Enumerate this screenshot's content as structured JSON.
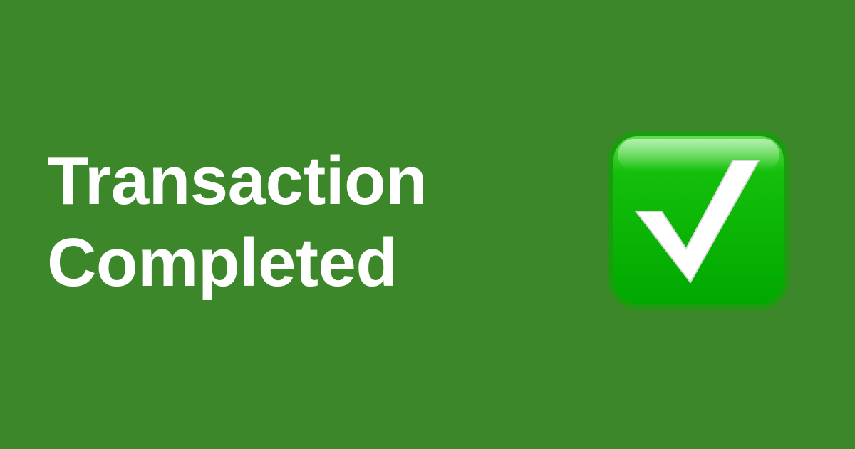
{
  "banner": {
    "background_color": "#3c8729",
    "text_color": "#ffffff",
    "headline": {
      "line1": "Transaction",
      "line2": "Completed"
    },
    "icon": {
      "name": "check-mark-button-icon",
      "glyph": "✅",
      "colors": {
        "border": "#1e9a10",
        "fill_top": "#5ee04e",
        "fill_bottom": "#00a800",
        "check": "#ffffff"
      }
    }
  }
}
